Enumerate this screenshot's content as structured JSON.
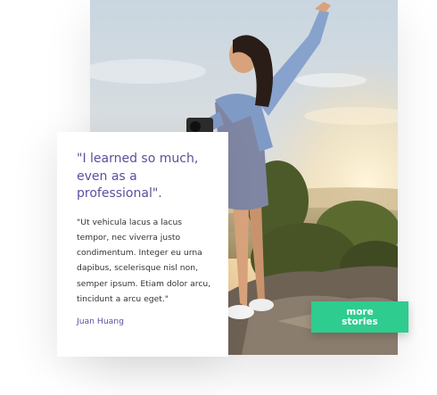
{
  "testimonial": {
    "headline": "\"I learned so much, even as a professional\".",
    "body": "\"Ut vehicula lacus a lacus tempor, nec viverra justo condimentum. Integer eu urna dapibus, scelerisque nisl non, semper ipsum. Etiam dolor arcu, tincidunt a arcu eget.\"",
    "author": "Juan Huang"
  },
  "cta": {
    "label": "more stories"
  },
  "colors": {
    "accent": "#5b4f9e",
    "button": "#2ecc8f",
    "body_text": "#333333"
  },
  "photo": {
    "icon": "person-on-mountain-photo"
  }
}
